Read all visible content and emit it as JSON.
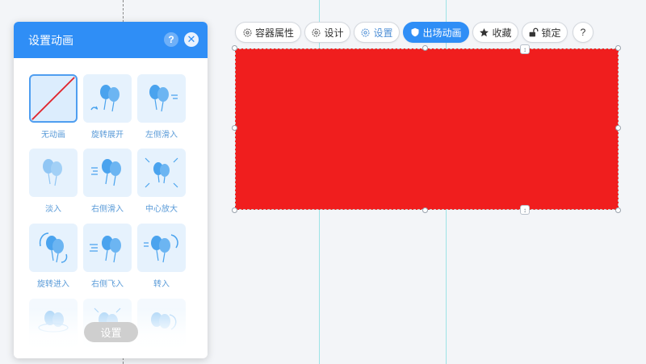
{
  "panel": {
    "title": "设置动画",
    "help_label": "?",
    "close_label": "✕",
    "set_button": "设置",
    "animations": [
      {
        "label": "无动画",
        "icon": "no-animation-icon"
      },
      {
        "label": "旋转展开",
        "icon": "rotate-expand-icon"
      },
      {
        "label": "左侧滑入",
        "icon": "slide-left-icon"
      },
      {
        "label": "淡入",
        "icon": "fade-in-icon"
      },
      {
        "label": "右侧滑入",
        "icon": "slide-right-icon"
      },
      {
        "label": "中心放大",
        "icon": "zoom-center-icon"
      },
      {
        "label": "旋转进入",
        "icon": "rotate-in-icon"
      },
      {
        "label": "右侧飞入",
        "icon": "fly-right-icon"
      },
      {
        "label": "转入",
        "icon": "turn-in-icon"
      }
    ]
  },
  "toolbar": {
    "container_props": "容器属性",
    "design": "设计",
    "settings": "设置",
    "exit_animation": "出场动画",
    "favorite": "收藏",
    "lock": "锁定",
    "help": "?"
  },
  "colors": {
    "accent": "#2f8ef6",
    "selected_block": "#f01e1e",
    "balloon": "#4aa3ee"
  }
}
